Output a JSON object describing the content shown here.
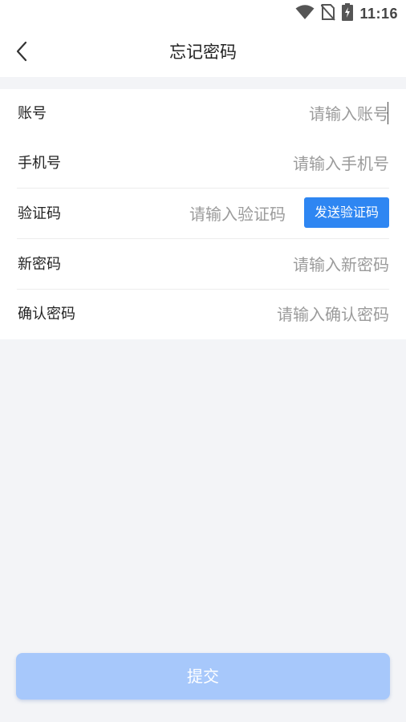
{
  "status_bar": {
    "time": "11:16",
    "icons": [
      "wifi-icon",
      "no-sim-icon",
      "battery-charging-icon"
    ]
  },
  "nav": {
    "title": "忘记密码",
    "back_icon": "chevron-left-icon"
  },
  "form": {
    "account": {
      "label": "账号",
      "placeholder": "请输入账号",
      "value": ""
    },
    "phone": {
      "label": "手机号",
      "placeholder": "请输入手机号",
      "value": ""
    },
    "code": {
      "label": "验证码",
      "placeholder": "请输入验证码",
      "value": "",
      "send_button": "发送验证码"
    },
    "new_password": {
      "label": "新密码",
      "placeholder": "请输入新密码",
      "value": ""
    },
    "confirm_password": {
      "label": "确认密码",
      "placeholder": "请输入确认密码",
      "value": ""
    }
  },
  "submit": {
    "label": "提交"
  },
  "colors": {
    "page_background": "#f3f4f7",
    "primary": "#2e86f2",
    "submit_disabled": "#a7c8fb",
    "placeholder": "#9b9b9b"
  }
}
